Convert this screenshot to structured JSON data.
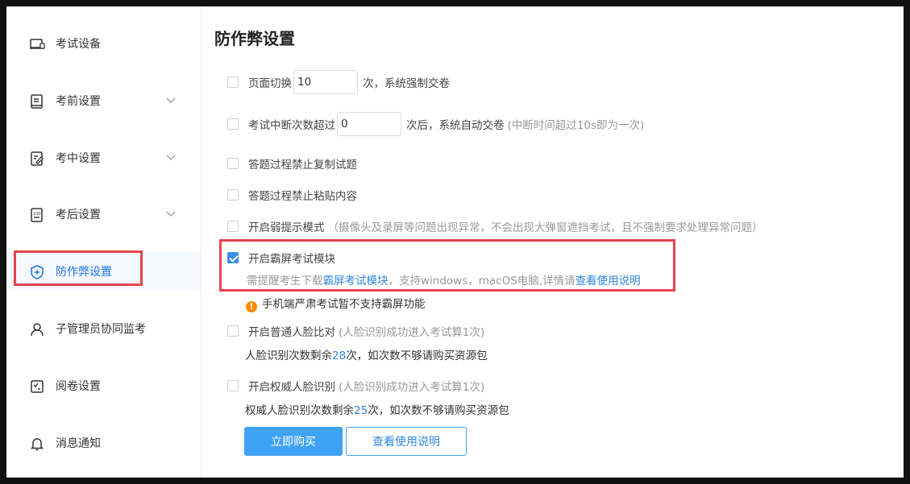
{
  "sidebar": {
    "items": [
      {
        "label": "考试设备",
        "icon": "laptop-icon",
        "has_chevron": false
      },
      {
        "label": "考前设置",
        "icon": "clipboard-icon",
        "has_chevron": true
      },
      {
        "label": "考中设置",
        "icon": "edit-document-icon",
        "has_chevron": true
      },
      {
        "label": "考后设置",
        "icon": "score-sheet-icon",
        "has_chevron": true
      },
      {
        "label": "防作弊设置",
        "icon": "shield-icon",
        "has_chevron": false,
        "active": true
      },
      {
        "label": "子管理员协同监考",
        "icon": "user-icon",
        "has_chevron": false
      },
      {
        "label": "阅卷设置",
        "icon": "grading-icon",
        "has_chevron": false
      },
      {
        "label": "消息通知",
        "icon": "bell-icon",
        "has_chevron": false
      }
    ]
  },
  "main": {
    "title": "防作弊设置",
    "page_switch": {
      "label": "页面切换",
      "value": "10",
      "suffix": "次，系统强制交卷",
      "checked": false
    },
    "interrupt": {
      "label": "考试中断次数超过",
      "value": "0",
      "suffix": "次后，系统自动交卷",
      "hint": "(中断时间超过10s即为一次)",
      "checked": false
    },
    "no_copy": {
      "label": "答题过程禁止复制试题",
      "checked": false
    },
    "no_paste": {
      "label": "答题过程禁止粘贴内容",
      "checked": false
    },
    "weak_hint": {
      "label": "开启弱提示模式",
      "hint": "（摄像头及录屏等问题出现异常，不会出现大弹窗遮挡考试，且不强制要求处理异常问题）",
      "checked": false
    },
    "lockdown": {
      "label": "开启霸屏考试模块",
      "checked": true,
      "desc_prefix": "需提醒考生下载",
      "desc_link": "霸屏考试模块",
      "desc_middle": "，支持windows，macOS电脑,详情请",
      "desc_link2": "查看使用说明",
      "warning": "手机端严肃考试暂不支持霸屏功能"
    },
    "face_compare": {
      "label": "开启普通人脸比对",
      "hint": "(人脸识别成功进入考试算1次)",
      "checked": false,
      "remaining_prefix": "人脸识别次数剩余",
      "remaining_count": "28",
      "remaining_suffix": "次，如次数不够请购买资源包"
    },
    "auth_face": {
      "label": "开启权威人脸识别",
      "hint": "(人脸识别成功进入考试算1次)",
      "checked": false,
      "remaining_prefix": "权威人脸识别次数剩余",
      "remaining_count": "25",
      "remaining_suffix": "次，如次数不够请购买资源包"
    },
    "buy_button": "立即购买",
    "guide_button": "查看使用说明"
  },
  "colors": {
    "accent": "#3fa3f5",
    "link": "#2f87e0",
    "highlight_border": "#e8434d",
    "warning": "#ff8a00"
  }
}
